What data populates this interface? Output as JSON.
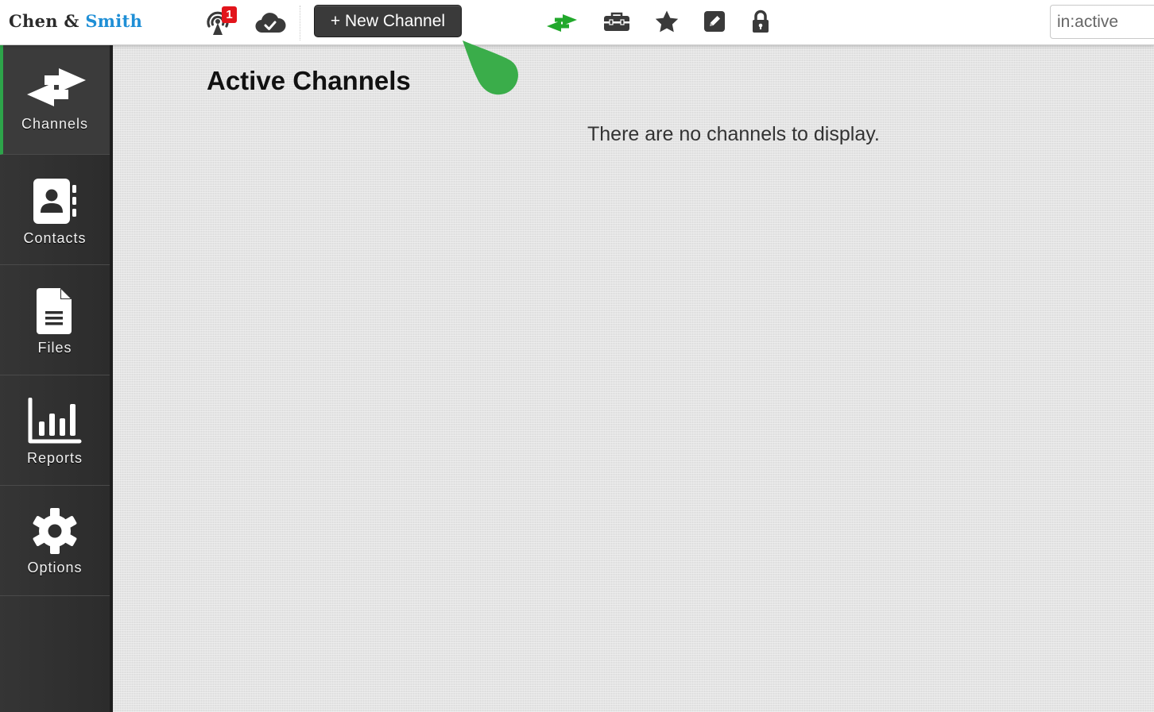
{
  "brand": {
    "part1": "Chen &",
    "part2": "Smith"
  },
  "toolbar": {
    "notification_count": "1",
    "new_channel_label": "+ New Channel",
    "icons": [
      "signal-alert-icon",
      "cloud-check-icon",
      "swap-arrows-icon",
      "toolbox-icon",
      "star-icon",
      "edit-icon",
      "lock-icon"
    ]
  },
  "search": {
    "value": "in:active"
  },
  "sidebar": {
    "items": [
      {
        "label": "Channels",
        "icon": "swap-arrows-icon",
        "active": true
      },
      {
        "label": "Contacts",
        "icon": "contact-book-icon"
      },
      {
        "label": "Files",
        "icon": "file-icon"
      },
      {
        "label": "Reports",
        "icon": "bar-chart-icon"
      },
      {
        "label": "Options",
        "icon": "gear-icon"
      }
    ]
  },
  "main": {
    "title": "Active Channels",
    "empty_message": "There are no channels to display."
  },
  "colors": {
    "accent_green": "#2da44a",
    "brand_blue": "#1f8fd6",
    "badge_red": "#e2141b"
  }
}
